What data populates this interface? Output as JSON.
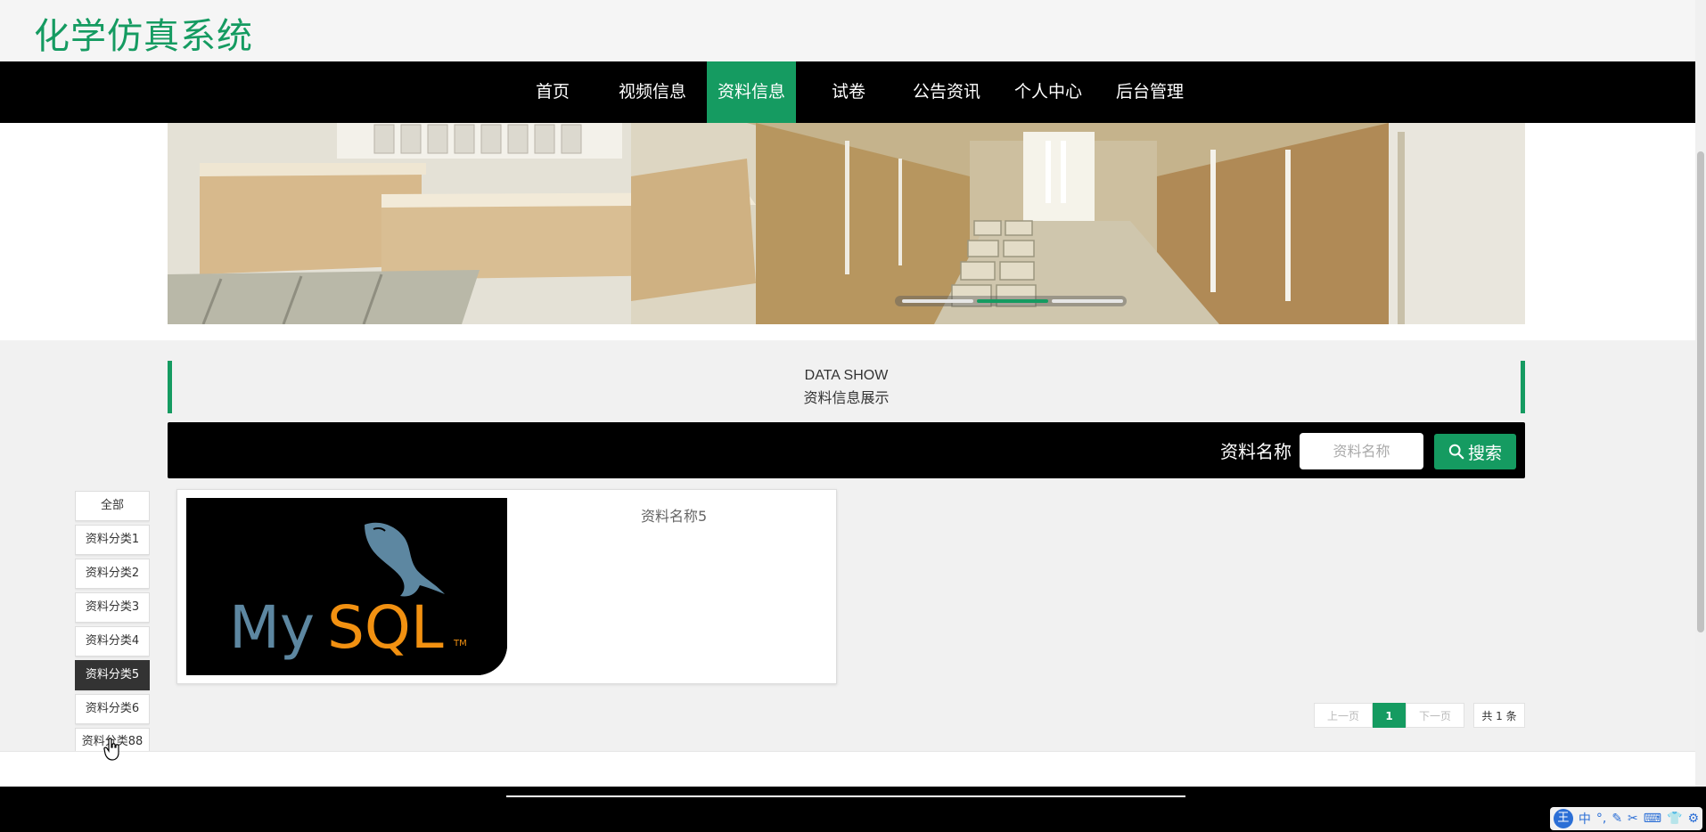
{
  "site": {
    "title": "化学仿真系统"
  },
  "nav": {
    "items": [
      {
        "label": "首页",
        "active": false
      },
      {
        "label": "视频信息",
        "active": false
      },
      {
        "label": "资料信息",
        "active": true
      },
      {
        "label": "试卷",
        "active": false
      },
      {
        "label": "公告资讯",
        "active": false
      },
      {
        "label": "个人中心",
        "active": false
      },
      {
        "label": "后台管理",
        "active": false
      }
    ]
  },
  "banner": {
    "slide_count": 3,
    "active_slide": 2
  },
  "section": {
    "title_en": "DATA SHOW",
    "title_cn": "资料信息展示"
  },
  "search": {
    "label": "资料名称",
    "placeholder": "资料名称",
    "value": "",
    "button_label": "搜索"
  },
  "categories": {
    "items": [
      {
        "label": "全部",
        "active": false
      },
      {
        "label": "资料分类1",
        "active": false
      },
      {
        "label": "资料分类2",
        "active": false
      },
      {
        "label": "资料分类3",
        "active": false
      },
      {
        "label": "资料分类4",
        "active": false
      },
      {
        "label": "资料分类5",
        "active": true
      },
      {
        "label": "资料分类6",
        "active": false
      },
      {
        "label": "资料分类88",
        "active": false
      }
    ]
  },
  "results": {
    "items": [
      {
        "title": "资料名称5",
        "image_label": "MySQL"
      }
    ]
  },
  "pagination": {
    "prev_label": "上一页",
    "current_page": "1",
    "next_label": "下一页",
    "total_label": "共 1 条"
  },
  "ime": {
    "logo": "王",
    "mode": "中",
    "punct": "°,"
  },
  "colors": {
    "accent": "#159b61",
    "nav_bg": "#000000",
    "page_bg": "#f1f1f1"
  }
}
